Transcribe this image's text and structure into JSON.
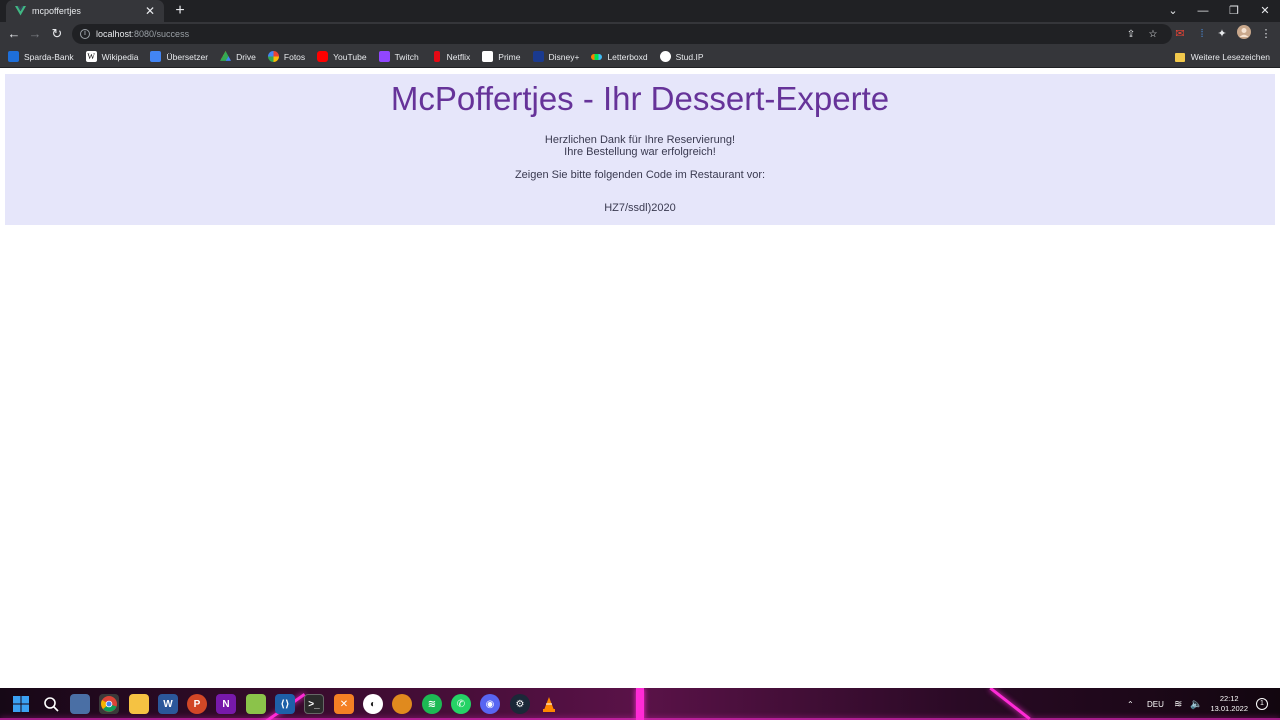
{
  "browser": {
    "tab": {
      "title": "mcpoffertjes",
      "close": "✕"
    },
    "new_tab": "+",
    "window_controls": {
      "tab_search": "⌄",
      "minimize": "—",
      "restore": "❐",
      "close": "✕"
    },
    "url": {
      "host": "localhost",
      "rest": ":8080/success"
    },
    "nav": {
      "back": "←",
      "forward": "→",
      "reload": "↻"
    },
    "bookmarks": [
      {
        "label": "Sparda-Bank",
        "icon": "bank-icon",
        "color": "#1e6fd9"
      },
      {
        "label": "Wikipedia",
        "icon": "wikipedia-icon",
        "color": "#ffffff"
      },
      {
        "label": "Übersetzer",
        "icon": "translate-icon",
        "color": "#4285f4"
      },
      {
        "label": "Drive",
        "icon": "drive-icon",
        "color": "#34a853"
      },
      {
        "label": "Fotos",
        "icon": "photos-icon",
        "color": "#fbbc05"
      },
      {
        "label": "YouTube",
        "icon": "youtube-icon",
        "color": "#ff0000"
      },
      {
        "label": "Twitch",
        "icon": "twitch-icon",
        "color": "#9146ff"
      },
      {
        "label": "Netflix",
        "icon": "netflix-icon",
        "color": "#e50914"
      },
      {
        "label": "Prime",
        "icon": "prime-icon",
        "color": "#ffffff"
      },
      {
        "label": "Disney+",
        "icon": "disney-icon",
        "color": "#1a3a8f"
      },
      {
        "label": "Letterboxd",
        "icon": "letterboxd-icon",
        "color": "#40bcf4"
      },
      {
        "label": "Stud.IP",
        "icon": "studip-icon",
        "color": "#ffffff"
      }
    ],
    "other_bookmarks": "Weitere Lesezeichen"
  },
  "page": {
    "heading": "McPoffertjes - Ihr Dessert-Experte",
    "thanks": "Herzlichen Dank für Ihre Reservierung!",
    "success": "Ihre Bestellung war erfolgreich!",
    "instruction": "Zeigen Sie bitte folgenden Code im Restaurant vor:",
    "code": "HZ7/ssdl)2020"
  },
  "taskbar": {
    "apps": [
      "start",
      "search",
      "explorer-view",
      "chrome",
      "file-explorer",
      "word",
      "powerpoint",
      "onenote",
      "notepad",
      "vscode",
      "terminal",
      "xampp",
      "steam-link",
      "app-orange",
      "spotify",
      "whatsapp",
      "discord",
      "steam",
      "vlc"
    ],
    "language": "DEU",
    "time": "22:12",
    "date": "13.01.2022"
  },
  "colors": {
    "heading": "#663399",
    "panel_bg": "#e6e6fa",
    "browser_dark": "#202124",
    "browser_toolbar": "#35363a"
  }
}
